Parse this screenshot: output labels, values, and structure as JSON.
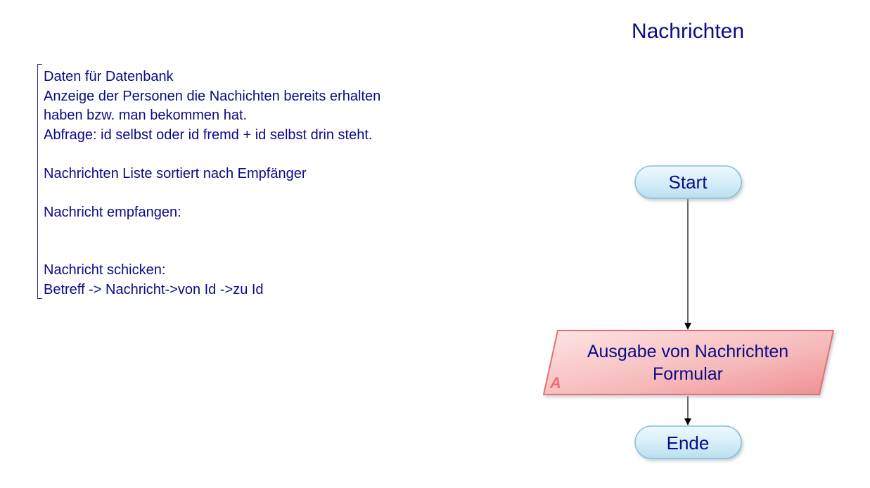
{
  "diagram": {
    "title": "Nachrichten",
    "note_lines": [
      "Daten für Datenbank",
      "Anzeige der Personen die Nachichten bereits erhalten",
      "haben bzw. man bekommen hat.",
      "Abfrage: id selbst oder id fremd + id selbst drin steht.",
      "",
      "Nachrichten Liste sortiert nach Empfänger",
      "",
      "Nachricht empfangen:",
      "",
      "",
      "Nachricht schicken:",
      "Betreff -> Nachricht->von Id ->zu Id"
    ],
    "nodes": {
      "start": {
        "label": "Start",
        "shape": "terminator"
      },
      "output": {
        "label_line1": "Ausgabe von Nachrichten",
        "label_line2": "Formular",
        "marker": "A",
        "shape": "parallelogram-io"
      },
      "end": {
        "label": "Ende",
        "shape": "terminator"
      }
    },
    "edges": [
      {
        "from": "start",
        "to": "output"
      },
      {
        "from": "output",
        "to": "end"
      }
    ],
    "colors": {
      "text": "#0b0b86",
      "terminator_fill": "#d2ecf7",
      "terminator_stroke": "#7fb9d4",
      "io_fill": "#f3a9aa",
      "io_stroke": "#e26a6c",
      "marker": "#ee6f72"
    }
  }
}
